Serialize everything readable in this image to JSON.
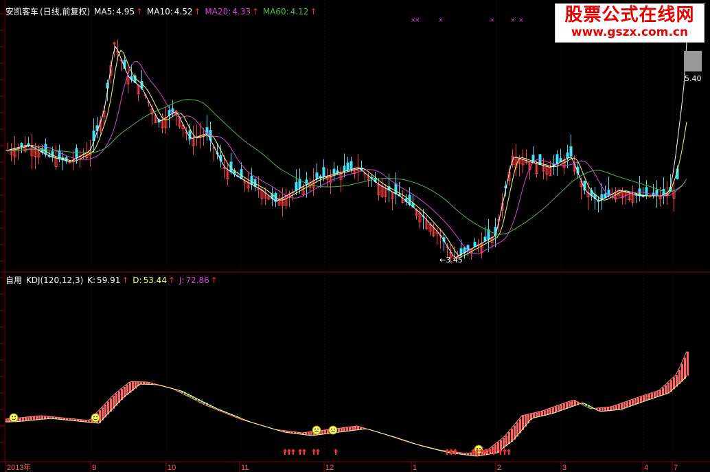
{
  "price_panel": {
    "stock_name": "安凯客车",
    "period": "(日线,前复权)",
    "ma5_label": "MA5:",
    "ma5_value": "4.95",
    "ma10_label": "MA10:",
    "ma10_value": "4.52",
    "ma20_label": "MA20:",
    "ma20_value": "4.33",
    "ma60_label": "MA60:",
    "ma60_value": "4.12",
    "up_arrow": "↑",
    "high_label": "5.40",
    "low_label": "←3.45"
  },
  "indicator_panel": {
    "name": "自用",
    "params": "KDJ(120,12,3)",
    "k_label": "K:",
    "k_value": "59.91",
    "d_label": "D:",
    "d_value": "53.44",
    "j_label": "J:",
    "j_value": "72.86",
    "up_arrow": "↑"
  },
  "watermark": {
    "title": "股票公式在线网",
    "url": "www.gszx.com.cn"
  },
  "time_axis": [
    "2013年",
    "9",
    "10",
    "11",
    "12",
    "1",
    "2",
    "3",
    "4",
    "7"
  ],
  "colors": {
    "up_candle": "#ff4040",
    "down_candle": "#40e0ff",
    "ma5": "#ffffff",
    "ma10": "#ffff66",
    "ma20": "#e040e0",
    "ma60": "#40c040",
    "label_white": "#ffffff",
    "label_yellow": "#ffff66",
    "label_magenta": "#e040e0",
    "label_green": "#40c040",
    "grid": "#8b0000"
  },
  "chart_data": {
    "type": "candlestick",
    "x_categories": [
      "2013年",
      "9",
      "10",
      "11",
      "12",
      "1",
      "2",
      "3",
      "4",
      "7"
    ],
    "price_series_approx_close": [
      3.9,
      4.0,
      3.95,
      4.05,
      4.0,
      3.9,
      4.0,
      4.6,
      4.9,
      4.6,
      4.7,
      4.4,
      4.3,
      4.0,
      4.1,
      3.95,
      3.8,
      3.7,
      3.75,
      3.8,
      3.9,
      4.0,
      3.9,
      3.85,
      3.8,
      3.7,
      3.6,
      3.5,
      3.45,
      3.5,
      3.6,
      4.2,
      4.3,
      4.0,
      4.1,
      4.2,
      4.0,
      3.9,
      4.0,
      4.1,
      4.0,
      3.9,
      4.2,
      5.4
    ],
    "markers": {
      "high": 5.4,
      "low": 3.45
    },
    "indicator": {
      "name": "KDJ",
      "K": 59.91,
      "D": 53.44,
      "J": 72.86
    }
  }
}
